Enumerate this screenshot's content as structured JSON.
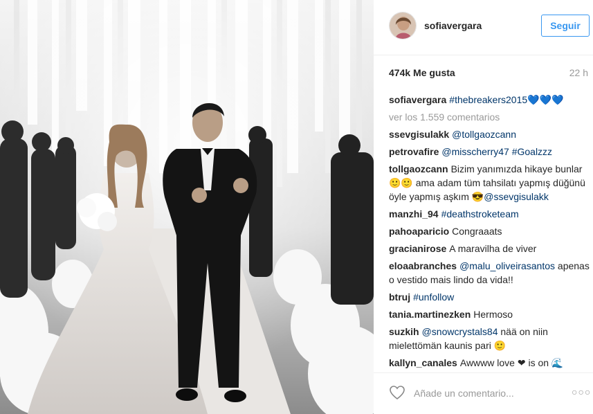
{
  "post": {
    "username": "sofiavergara",
    "follow_label": "Seguir",
    "likes": "474k Me gusta",
    "time": "22 h",
    "caption": {
      "user": "sofiavergara",
      "tag": "#thebreakers2015",
      "hearts": "💙💙💙"
    },
    "view_comments": "ver los 1.559 comentarios",
    "comments": [
      {
        "user": "ssevgisulakk",
        "parts": [
          {
            "t": "@tollgaozcann",
            "tag": true
          }
        ]
      },
      {
        "user": "petrovafire",
        "parts": [
          {
            "t": "@misscherry47",
            "tag": true
          },
          {
            "t": " ",
            "tag": false
          },
          {
            "t": "#Goalzzz",
            "tag": true
          }
        ]
      },
      {
        "user": "tollgaozcann",
        "parts": [
          {
            "t": "Bizim yanımızda hikaye bunlar 🙂🙂 ama adam tüm tahsilatı yapmış düğünü öyle yapmış aşkım 😎",
            "tag": false
          },
          {
            "t": "@ssevgisulakk",
            "tag": true
          }
        ]
      },
      {
        "user": "manzhi_94",
        "parts": [
          {
            "t": "#deathstroketeam",
            "tag": true
          }
        ]
      },
      {
        "user": "pahoaparicio",
        "parts": [
          {
            "t": "Congraaats",
            "tag": false
          }
        ]
      },
      {
        "user": "gracianirose",
        "parts": [
          {
            "t": "A maravilha de viver",
            "tag": false
          }
        ]
      },
      {
        "user": "eloaabranches",
        "parts": [
          {
            "t": "@malu_oliveirasantos",
            "tag": true
          },
          {
            "t": " apenas o vestido mais lindo da vida!!",
            "tag": false
          }
        ]
      },
      {
        "user": "btruj",
        "parts": [
          {
            "t": "#unfollow",
            "tag": true
          }
        ]
      },
      {
        "user": "tania.martinezken",
        "parts": [
          {
            "t": "Hermoso",
            "tag": false
          }
        ]
      },
      {
        "user": "suzkih",
        "parts": [
          {
            "t": "@snowcrystals84",
            "tag": true
          },
          {
            "t": " nää on niin mielettömän kaunis pari 🙂",
            "tag": false
          }
        ]
      },
      {
        "user": "kallyn_canales",
        "parts": [
          {
            "t": "Awwww love ❤ is on 🌊",
            "tag": false
          }
        ]
      }
    ],
    "add_comment_placeholder": "Añade un comentario...",
    "more_options": "○○○"
  },
  "icons": {
    "like": "heart-outline-icon",
    "more": "more-dots-icon"
  },
  "colors": {
    "accent": "#3897f0",
    "tag": "#003569",
    "muted": "#999999"
  }
}
